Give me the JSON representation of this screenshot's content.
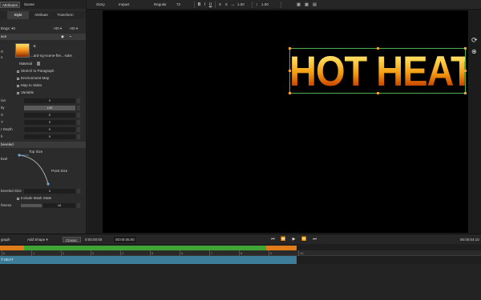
{
  "left_panel": {
    "tabs_top": [
      "Attributes",
      "Scene"
    ],
    "tabs_second": [
      "Style",
      "Attribute",
      "Transform"
    ],
    "settings_label": "ttings: ▾0",
    "settings_values": [
      "+00 ▾",
      "+00 ▾"
    ],
    "layer_label": "ace",
    "texture": {
      "label_a": "rt",
      "label_b": "s",
      "file": "...ard-ng-scene-fire...-tabs"
    },
    "material_label": "Material",
    "checkboxes": [
      "Stretch to Paragraph",
      "Environment Map",
      "Map to Sides",
      "Variable"
    ],
    "rows1": [
      {
        "label": "ion",
        "value": "0"
      },
      {
        "label": "ity",
        "value": "100"
      },
      {
        "label": "  X",
        "value": "0"
      },
      {
        "label": "  Y",
        "value": "0"
      },
      {
        "label": "r Depth",
        "value": "0"
      },
      {
        "label": "h",
        "value": "0"
      }
    ],
    "section_label": "beveled",
    "curve": {
      "top_label": "Top Size",
      "left_label": "bvel",
      "point_label": "Point Size"
    },
    "rows2": [
      {
        "label": "beveled Size",
        "value": "0"
      },
      {
        "label": "",
        "value": "Include Mask State"
      },
      {
        "label": "htness",
        "value": "16"
      }
    ]
  },
  "toolbar": {
    "font_menu": "Glory",
    "font_name": "Impact",
    "style": "Regular",
    "size": "72",
    "bold": "B",
    "italic": "I",
    "underline": "U",
    "tracking": "1.00",
    "leading": "1.00"
  },
  "canvas": {
    "text": "HOT HEAT",
    "side_icons": [
      "refresh-icon",
      "globe-icon"
    ]
  },
  "playback": {
    "left_label": "graph",
    "add_shape": "Add Shape ▾",
    "mode": "Classic",
    "timecode": "0:00:00:00",
    "duration": "00:00:05:00",
    "end_time": "00:00:04:10"
  },
  "timeline": {
    "ruler_labels": [
      "0",
      "1",
      "2",
      "3",
      "4",
      "5",
      "6",
      "7",
      "8",
      "9",
      "10"
    ],
    "clip_label": "T HEAT",
    "colors": {
      "orange": "#e07b1a",
      "green": "#3fa535",
      "clip": "#3d7d9a"
    }
  }
}
